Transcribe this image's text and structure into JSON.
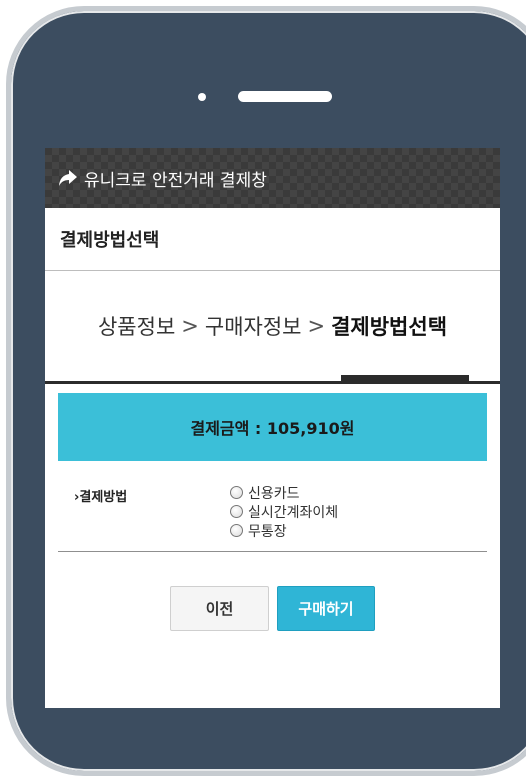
{
  "window": {
    "title": "유니크로 안전거래 결제창",
    "icon": "share-arrow-icon"
  },
  "header": {
    "title": "결제방법선택"
  },
  "steps": [
    {
      "label": "상품정보"
    },
    {
      "label": "구매자정보"
    },
    {
      "label": "결제방법선택",
      "active": true
    }
  ],
  "step_separator": ">",
  "amount": {
    "text": "결제금액 : 105,910원"
  },
  "payment": {
    "label": "›결제방법",
    "options": [
      {
        "label": "신용카드"
      },
      {
        "label": "실시간계좌이체"
      },
      {
        "label": "무통장"
      }
    ]
  },
  "buttons": {
    "prev": "이전",
    "buy": "구매하기"
  },
  "colors": {
    "accent": "#3bbfd8",
    "button_primary": "#2fb5d6",
    "phone_body": "#3c4d60"
  }
}
